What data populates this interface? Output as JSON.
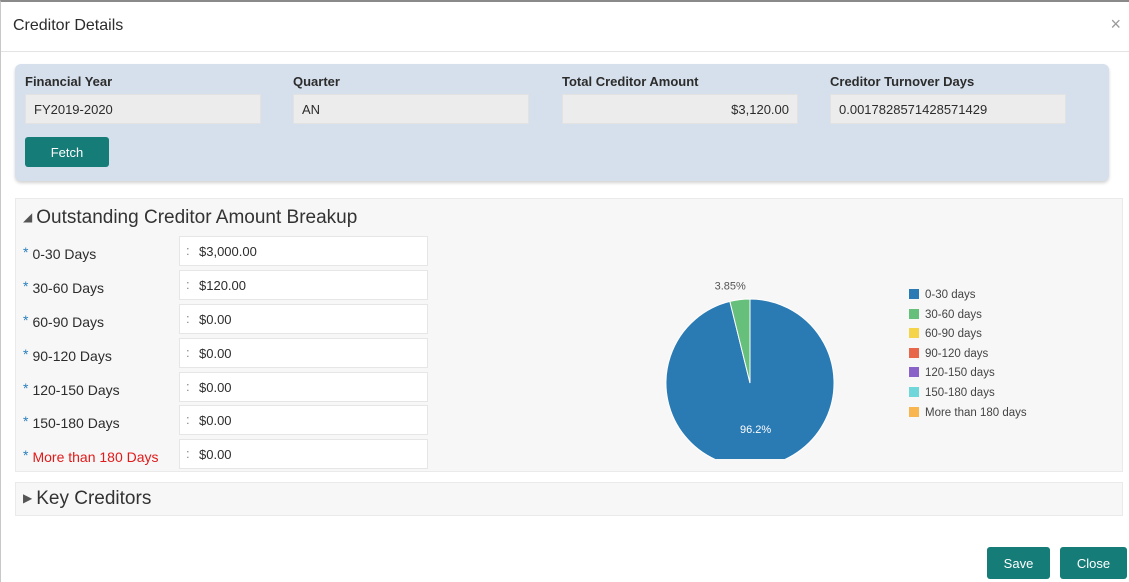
{
  "dialog": {
    "title": "Creditor Details",
    "close_glyph": "×"
  },
  "filters": {
    "financial_year": {
      "label": "Financial Year",
      "value": "FY2019-2020"
    },
    "quarter": {
      "label": "Quarter",
      "value": "AN"
    },
    "total_creditor_amount": {
      "label": "Total Creditor Amount",
      "value": "$3,120.00"
    },
    "creditor_turnover_days": {
      "label": "Creditor Turnover Days",
      "value": "0.0017828571428571429"
    },
    "fetch_label": "Fetch"
  },
  "breakup": {
    "title": "Outstanding Creditor Amount Breakup",
    "rows": [
      {
        "label": "0-30 Days",
        "value": "$3,000.00"
      },
      {
        "label": "30-60 Days",
        "value": "$120.00"
      },
      {
        "label": "60-90 Days",
        "value": "$0.00"
      },
      {
        "label": "90-120 Days",
        "value": "$0.00"
      },
      {
        "label": "120-150 Days",
        "value": "$0.00"
      },
      {
        "label": "150-180 Days",
        "value": "$0.00"
      },
      {
        "label": "More than 180 Days",
        "value": "$0.00"
      }
    ]
  },
  "chart_data": {
    "type": "pie",
    "categories": [
      "0-30 days",
      "30-60 days",
      "60-90 days",
      "90-120 days",
      "120-150 days",
      "150-180 days",
      "More than 180 days"
    ],
    "values": [
      3000,
      120,
      0,
      0,
      0,
      0,
      0
    ],
    "data_labels": [
      "96.2%",
      "3.85%"
    ],
    "colors": [
      "#2a7ab4",
      "#66bf7a",
      "#f5d44a",
      "#e8664a",
      "#8a63c8",
      "#6fd6da",
      "#f8b550"
    ],
    "legend_position": "right"
  },
  "key_creditors": {
    "title": "Key Creditors"
  },
  "footer": {
    "save_label": "Save",
    "close_label": "Close"
  }
}
